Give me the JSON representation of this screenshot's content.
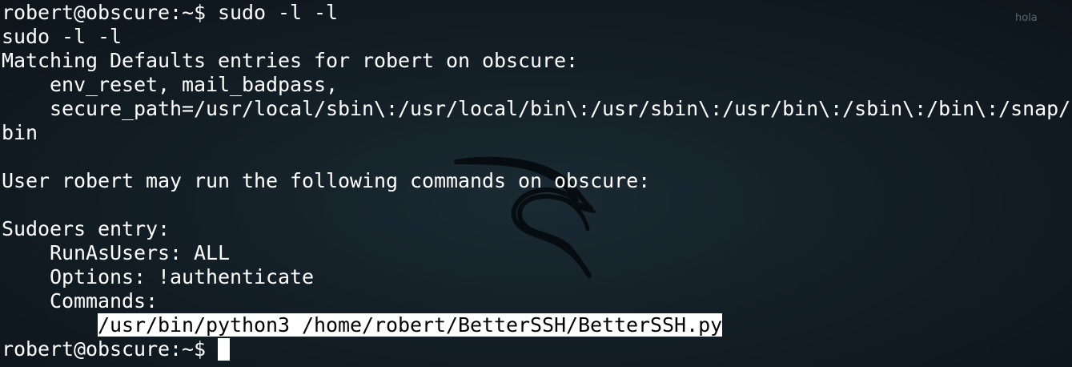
{
  "watermark": "hola",
  "terminal": {
    "line1": "robert@obscure:~$ sudo -l -l",
    "line2": "sudo -l -l",
    "line3": "Matching Defaults entries for robert on obscure:",
    "line4": "env_reset, mail_badpass,",
    "line5": "secure_path=/usr/local/sbin\\:/usr/local/bin\\:/usr/sbin\\:/usr/bin\\:/sbin\\:/bin\\:/snap/",
    "line6": "bin",
    "line8": "User robert may run the following commands on obscure:",
    "line10": "Sudoers entry:",
    "line11": "RunAsUsers: ALL",
    "line12": "Options: !authenticate",
    "line13": "Commands:",
    "line14": "/usr/bin/python3 /home/robert/BetterSSH/BetterSSH.py",
    "prompt": "robert@obscure:~$"
  }
}
